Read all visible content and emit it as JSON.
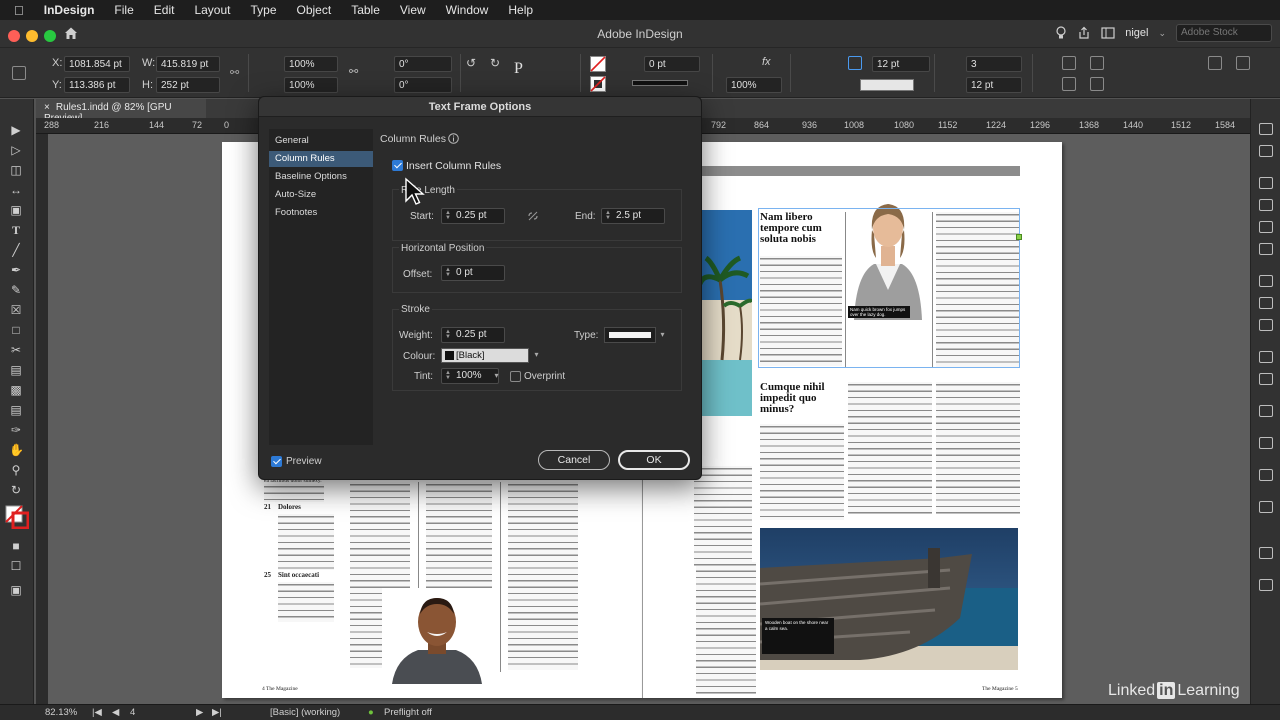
{
  "menubar": {
    "app": "InDesign",
    "items": [
      "File",
      "Edit",
      "Layout",
      "Type",
      "Object",
      "Table",
      "View",
      "Window",
      "Help"
    ]
  },
  "titlebar": {
    "title": "Adobe InDesign",
    "user": "nigel",
    "stock_placeholder": "Adobe Stock"
  },
  "control": {
    "x_label": "X:",
    "x_value": "1081.854 pt",
    "y_label": "Y:",
    "y_value": "113.386 pt",
    "w_label": "W:",
    "w_value": "415.819 pt",
    "h_label": "H:",
    "h_value": "252 pt",
    "scale_x": "100%",
    "scale_y": "100%",
    "rotate": "0°",
    "shear": "0°",
    "stroke_weight": "0 pt",
    "opacity": "100%",
    "gutter": "12 pt",
    "columns": "3",
    "col_width": "12 pt"
  },
  "tab": {
    "label": "Rules1.indd @ 82% [GPU Preview]"
  },
  "ruler": {
    "ticks": [
      "288",
      "216",
      "144",
      "72",
      "0",
      "792",
      "864",
      "936",
      "1008",
      "1080",
      "1152",
      "1224",
      "1296",
      "1368",
      "1440",
      "1512",
      "1584"
    ]
  },
  "dialog": {
    "title": "Text Frame Options",
    "nav": [
      "General",
      "Column Rules",
      "Baseline Options",
      "Auto-Size",
      "Footnotes"
    ],
    "section_title": "Column Rules",
    "insert_label": "Insert Column Rules",
    "rule_length_label": "Rule Length",
    "start_label": "Start:",
    "start_value": "0.25 pt",
    "end_label": "End:",
    "end_value": "2.5 pt",
    "horizontal_position_label": "Horizontal Position",
    "offset_label": "Offset:",
    "offset_value": "0 pt",
    "stroke_label": "Stroke",
    "weight_label": "Weight:",
    "weight_value": "0.25 pt",
    "type_label": "Type:",
    "colour_label": "Colour:",
    "colour_value": "[Black]",
    "tint_label": "Tint:",
    "tint_value": "100%",
    "overprint_label": "Overprint",
    "preview_label": "Preview",
    "cancel_label": "Cancel",
    "ok_label": "OK"
  },
  "page_left": {
    "items": [
      {
        "num": "21",
        "title": "Dolores"
      },
      {
        "num": "25",
        "title": "Sint occaecati"
      }
    ],
    "folio": "4  The Magazine",
    "intro_line": "ea facilibus dolor sumexy."
  },
  "page_right": {
    "headline1": "Nam libero tempore cum soluta nobis",
    "headline2": "Cumque nihil impedit quo minus?",
    "caption1": "Nam quick brown fox jumps over the lazy dog.",
    "caption2": "Wooden boat on the shore near a calm sea.",
    "folio": "The Magazine  5"
  },
  "status": {
    "zoom": "82.13%",
    "page": "4",
    "style": "[Basic] (working)",
    "preflight": "Preflight off"
  },
  "watermark": {
    "brand": "Linked",
    "in": "in",
    "suffix": "Learning"
  },
  "colors": {
    "accent": "#2d7ad6",
    "nav_selected": "#3c5a78"
  }
}
